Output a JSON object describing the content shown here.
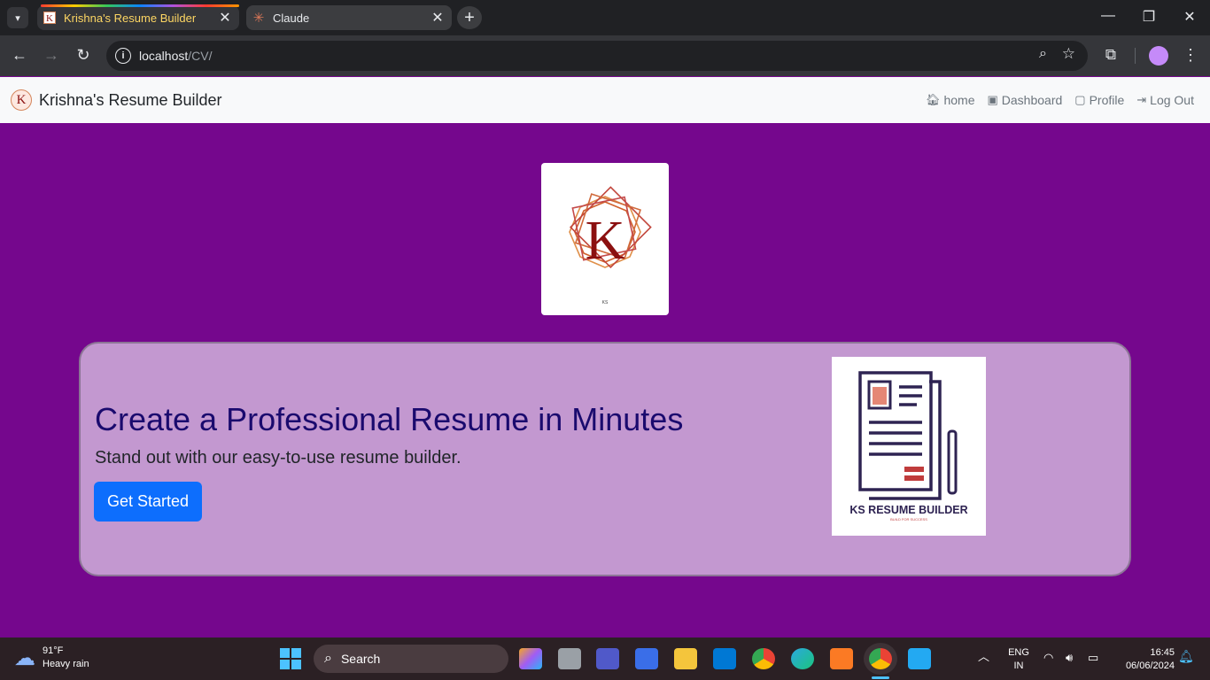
{
  "browser": {
    "tabs": [
      {
        "title": "Krishna's Resume Builder",
        "favicon": "k-logo-icon",
        "active": true
      },
      {
        "title": "Claude",
        "favicon": "claude-icon",
        "active": false
      }
    ],
    "url_host": "localhost",
    "url_path": "/CV/"
  },
  "navbar": {
    "brand": "Krishna's Resume Builder",
    "links": [
      {
        "label": "home",
        "icon": "house-icon"
      },
      {
        "label": "Dashboard",
        "icon": "box-icon"
      },
      {
        "label": "Profile",
        "icon": "person-badge-icon"
      },
      {
        "label": "Log Out",
        "icon": "logout-icon"
      }
    ]
  },
  "logo": {
    "letter": "K",
    "caption": "KS"
  },
  "hero": {
    "title": "Create a Professional Resume in Minutes",
    "subtitle": "Stand out with our easy-to-use resume builder.",
    "cta": "Get Started",
    "image_title": "KS RESUME BUILDER",
    "image_tagline": "BUILD FOR SUCCESS"
  },
  "taskbar": {
    "temperature": "91°F",
    "condition": "Heavy rain",
    "search_placeholder": "Search",
    "language": "ENG",
    "region": "IN",
    "time": "16:45",
    "date": "06/06/2024"
  },
  "colors": {
    "page_bg": "#75078d",
    "hero_bg": "#c398d0",
    "accent": "#0d6efd",
    "title": "#1a0a6e"
  }
}
